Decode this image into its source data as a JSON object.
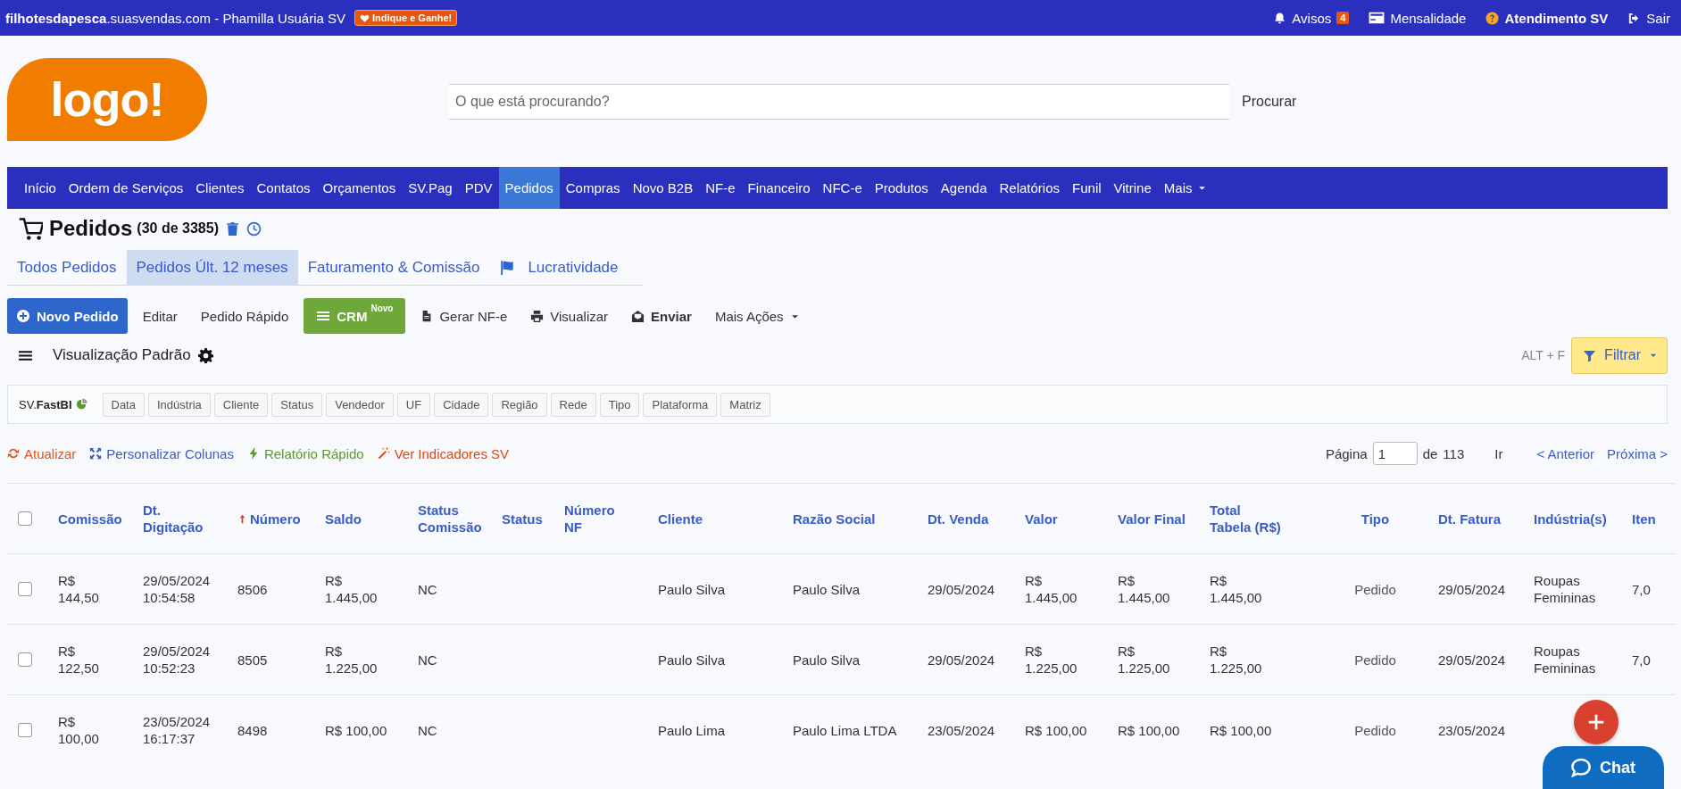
{
  "top_bar": {
    "site": "**filhotesdapesca**.suasvendas.com - Phamilla Usuária SV",
    "badge": "Indique e Ganhe!",
    "links": [
      {
        "kind": "bell",
        "label": "Avisos",
        "count": "4"
      },
      {
        "kind": "card",
        "label": "Mensalidade"
      },
      {
        "kind": "help",
        "label": "Atendimento SV"
      },
      {
        "kind": "exit",
        "label": "Sair"
      }
    ]
  },
  "header": {
    "logo": "logo!",
    "search": {
      "placeholder": "O que está procurando?"
    },
    "search_button": "Procurar"
  },
  "nav": [
    {
      "label": "Início",
      "selected": false,
      "dropdown": false
    },
    {
      "label": "Ordem de Serviços",
      "selected": false,
      "dropdown": false
    },
    {
      "label": "Clientes",
      "selected": false,
      "dropdown": false
    },
    {
      "label": "Contatos",
      "selected": false,
      "dropdown": false
    },
    {
      "label": "Orçamentos",
      "selected": false,
      "dropdown": false
    },
    {
      "label": "SV.Pag",
      "selected": false,
      "dropdown": false
    },
    {
      "label": "PDV",
      "selected": false,
      "dropdown": false
    },
    {
      "label": "Pedidos",
      "selected": true,
      "dropdown": false
    },
    {
      "label": "Compras",
      "selected": false,
      "dropdown": false
    },
    {
      "label": "Novo B2B",
      "selected": false,
      "dropdown": false
    },
    {
      "label": "NF-e",
      "selected": false,
      "dropdown": false
    },
    {
      "label": "Financeiro",
      "selected": false,
      "dropdown": false
    },
    {
      "label": "NFC-e",
      "selected": false,
      "dropdown": false
    },
    {
      "label": "Produtos",
      "selected": false,
      "dropdown": false
    },
    {
      "label": "Agenda",
      "selected": false,
      "dropdown": false
    },
    {
      "label": "Relatórios",
      "selected": false,
      "dropdown": false
    },
    {
      "label": "Funil",
      "selected": false,
      "dropdown": false
    },
    {
      "label": "Vitrine",
      "selected": false,
      "dropdown": false
    },
    {
      "label": "Mais",
      "selected": false,
      "dropdown": true
    }
  ],
  "page_title": {
    "title": "Pedidos",
    "count": "(30 de 3385)"
  },
  "tabs": [
    {
      "kind": "plain",
      "label": "Todos Pedidos",
      "selected": false
    },
    {
      "kind": "plain",
      "label": "Pedidos Últ. 12 meses",
      "selected": true
    },
    {
      "kind": "plain",
      "label": "Faturamento & Comissão",
      "selected": false
    },
    {
      "kind": "flag",
      "label": "Lucratividade",
      "selected": false
    }
  ],
  "toolbar": [
    {
      "kind": "primary",
      "label": "Novo Pedido"
    },
    {
      "kind": "plain",
      "label": "Editar"
    },
    {
      "kind": "plain",
      "label": "Pedido Rápido"
    },
    {
      "kind": "crm",
      "label": "CRM",
      "badge": "Novo"
    },
    {
      "kind": "file",
      "label": "Gerar NF-e"
    },
    {
      "kind": "print",
      "label": "Visualizar"
    },
    {
      "kind": "send",
      "label": "Enviar"
    },
    {
      "kind": "dropdown",
      "label": "Mais Ações"
    }
  ],
  "view": {
    "label": "Visualização Padrão",
    "shortcut": "ALT + F",
    "filter_button": "Filtrar"
  },
  "fastbi": {
    "label": "SV.**FastBI**",
    "chips": [
      "Data",
      "Indústria",
      "Cliente",
      "Status",
      "Vendedor",
      "UF",
      "Cidade",
      "Região",
      "Rede",
      "Tipo",
      "Plataforma",
      "Matriz"
    ]
  },
  "actions": [
    {
      "kind": "refresh",
      "label": "Atualizar",
      "color": "#e0561b"
    },
    {
      "kind": "columns",
      "label": "Personalizar Colunas",
      "color": "#3a5cc6"
    },
    {
      "kind": "bolt",
      "label": "Relatório Rápido",
      "color": "#5a9a2a"
    },
    {
      "kind": "wand",
      "label": "Ver Indicadores SV",
      "color": "#d9480f"
    }
  ],
  "pagination": {
    "label": "Página",
    "value": "1",
    "of": "de",
    "total": "113",
    "go": "Ir",
    "previous": "< Anterior",
    "next": "Próxima >"
  },
  "table": {
    "select_all": {
      "checked": false
    },
    "columns": [
      {
        "label": "Comissão",
        "sorted": false
      },
      {
        "label": "Dt. Digitação",
        "sorted": false
      },
      {
        "label": "Número",
        "sorted": true
      },
      {
        "label": "Saldo",
        "sorted": false
      },
      {
        "label": "Status Comissão",
        "sorted": false
      },
      {
        "label": "Status",
        "sorted": false
      },
      {
        "label": "Número NF",
        "sorted": false
      },
      {
        "label": "Cliente",
        "sorted": false
      },
      {
        "label": "Razão Social",
        "sorted": false
      },
      {
        "label": "Dt. Venda",
        "sorted": false
      },
      {
        "label": "Valor",
        "sorted": false
      },
      {
        "label": "Valor Final",
        "sorted": false
      },
      {
        "label": "Total Tabela (R$)",
        "sorted": false
      },
      {
        "label": "Tipo",
        "sorted": false
      },
      {
        "label": "Dt. Fatura",
        "sorted": false
      },
      {
        "label": "Indústria(s)",
        "sorted": false
      },
      {
        "label": "Iten",
        "sorted": false
      }
    ],
    "rows": [
      {
        "checked": false,
        "cells": [
          "R$ 144,50",
          "29/05/2024 10:54:58",
          "8506",
          "R$ 1.445,00",
          "NC",
          "",
          "",
          "Paulo Silva",
          "Paulo Silva",
          "29/05/2024",
          "R$ 1.445,00",
          "R$ 1.445,00",
          "R$ 1.445,00",
          "Pedido",
          "29/05/2024",
          "Roupas Femininas",
          "7,0"
        ]
      },
      {
        "checked": false,
        "cells": [
          "R$ 122,50",
          "29/05/2024 10:52:23",
          "8505",
          "R$ 1.225,00",
          "NC",
          "",
          "",
          "Paulo Silva",
          "Paulo Silva",
          "29/05/2024",
          "R$ 1.225,00",
          "R$ 1.225,00",
          "R$ 1.225,00",
          "Pedido",
          "29/05/2024",
          "Roupas Femininas",
          "7,0"
        ]
      },
      {
        "checked": false,
        "cells": [
          "R$ 100,00",
          "23/05/2024 16:17:37",
          "8498",
          "R$ 100,00",
          "NC",
          "",
          "",
          "Paulo Lima",
          "Paulo Lima LTDA",
          "23/05/2024",
          "R$ 100,00",
          "R$ 100,00",
          "R$ 100,00",
          "Pedido",
          "23/05/2024",
          "",
          ""
        ]
      }
    ]
  },
  "chat_button": "Chat"
}
